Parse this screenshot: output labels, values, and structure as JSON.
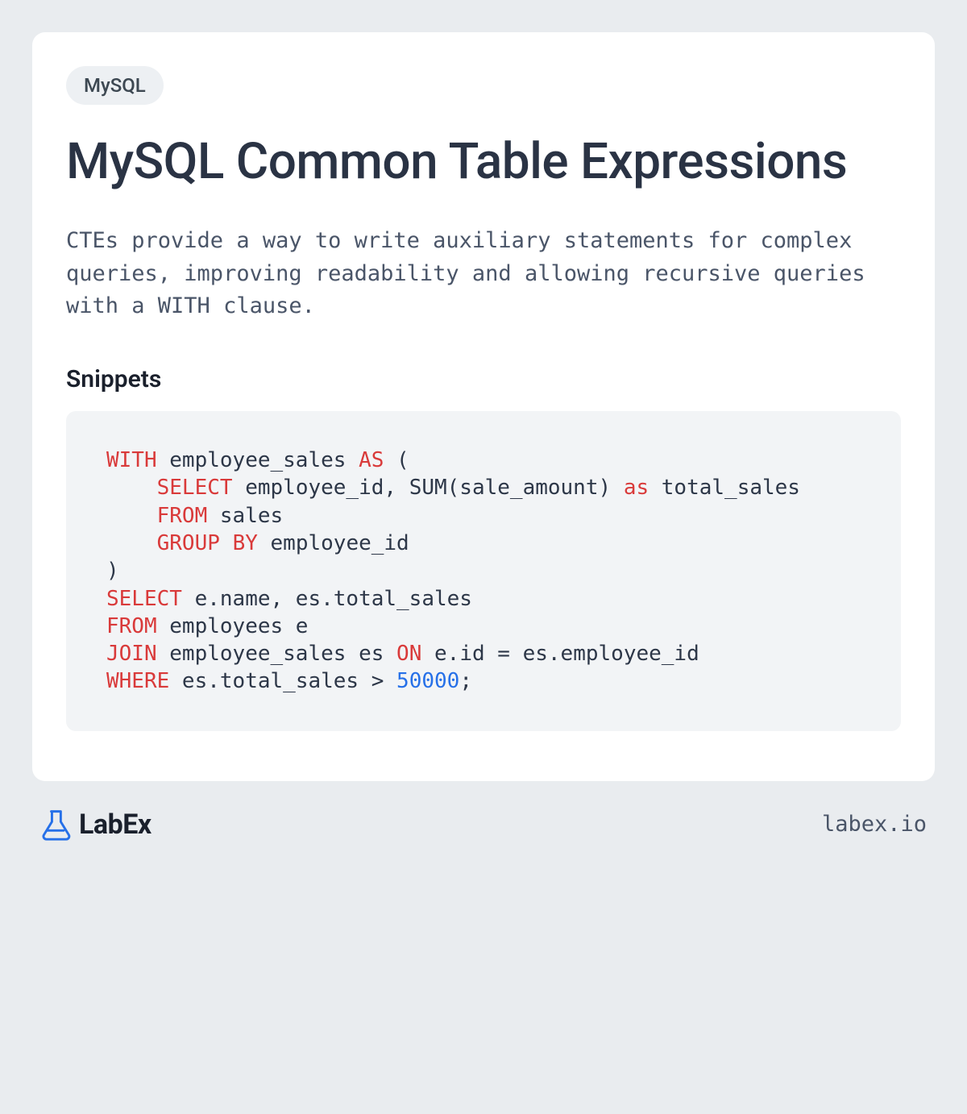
{
  "tag": "MySQL",
  "title": "MySQL Common Table Expressions",
  "description": "CTEs provide a way to write auxiliary statements for complex queries, improving readability and allowing recursive queries with a WITH clause.",
  "snippets_heading": "Snippets",
  "code": {
    "tokens": [
      {
        "t": "kw",
        "v": "WITH"
      },
      {
        "t": "tx",
        "v": " employee_sales "
      },
      {
        "t": "kw",
        "v": "AS"
      },
      {
        "t": "tx",
        "v": " (\n    "
      },
      {
        "t": "kw",
        "v": "SELECT"
      },
      {
        "t": "tx",
        "v": " employee_id, SUM(sale_amount) "
      },
      {
        "t": "kw",
        "v": "as"
      },
      {
        "t": "tx",
        "v": " total_sales\n    "
      },
      {
        "t": "kw",
        "v": "FROM"
      },
      {
        "t": "tx",
        "v": " sales\n    "
      },
      {
        "t": "kw",
        "v": "GROUP"
      },
      {
        "t": "tx",
        "v": " "
      },
      {
        "t": "kw",
        "v": "BY"
      },
      {
        "t": "tx",
        "v": " employee_id\n)\n"
      },
      {
        "t": "kw",
        "v": "SELECT"
      },
      {
        "t": "tx",
        "v": " e.name, es.total_sales\n"
      },
      {
        "t": "kw",
        "v": "FROM"
      },
      {
        "t": "tx",
        "v": " employees e\n"
      },
      {
        "t": "kw",
        "v": "JOIN"
      },
      {
        "t": "tx",
        "v": " employee_sales es "
      },
      {
        "t": "kw",
        "v": "ON"
      },
      {
        "t": "tx",
        "v": " e.id = es.employee_id\n"
      },
      {
        "t": "kw",
        "v": "WHERE"
      },
      {
        "t": "tx",
        "v": " es.total_sales > "
      },
      {
        "t": "num",
        "v": "50000"
      },
      {
        "t": "tx",
        "v": ";"
      }
    ]
  },
  "footer": {
    "brand": "LabEx",
    "site": "labex.io"
  },
  "colors": {
    "page_bg": "#e9ecef",
    "card_bg": "#ffffff",
    "tag_bg": "#edf0f3",
    "code_bg": "#f2f4f6",
    "keyword": "#d93a3a",
    "number": "#2670e8",
    "brand_accent": "#2670e8"
  }
}
